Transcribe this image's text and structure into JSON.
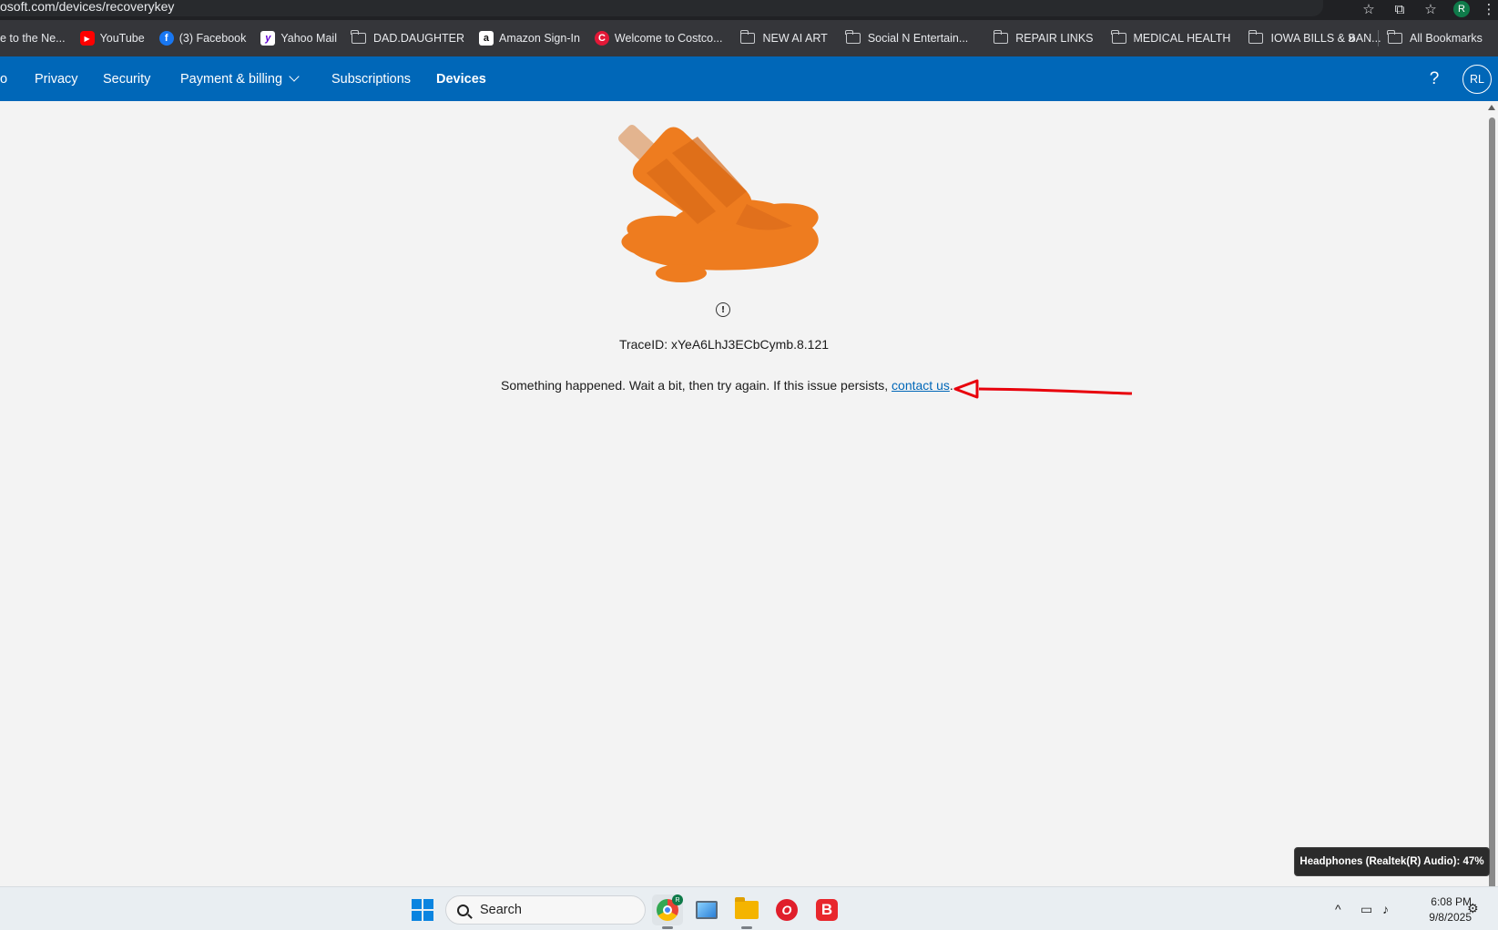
{
  "browser": {
    "url": "osoft.com/devices/recoverykey",
    "profile_initial": "R",
    "icons": [
      "star-icon",
      "extensions-icon",
      "bookmarks-icon",
      "profile-avatar",
      "menu-icon"
    ]
  },
  "bookmarks": {
    "items": [
      {
        "label": "e to the Ne...",
        "icon": "none"
      },
      {
        "label": "YouTube",
        "icon": "youtube-icon"
      },
      {
        "label": "(3) Facebook",
        "icon": "facebook-icon"
      },
      {
        "label": "Yahoo Mail",
        "icon": "yahoo-icon"
      },
      {
        "label": "DAD.DAUGHTER",
        "icon": "folder-icon"
      },
      {
        "label": "Amazon Sign-In",
        "icon": "amazon-icon"
      },
      {
        "label": "Welcome to Costco...",
        "icon": "costco-icon"
      },
      {
        "label": "NEW AI ART",
        "icon": "folder-icon"
      },
      {
        "label": "Social N Entertain...",
        "icon": "folder-icon"
      },
      {
        "label": "REPAIR LINKS",
        "icon": "folder-icon"
      },
      {
        "label": "MEDICAL HEALTH",
        "icon": "folder-icon"
      },
      {
        "label": "IOWA BILLS & BAN...",
        "icon": "folder-icon"
      }
    ],
    "more_label": "»",
    "all_bookmarks": "All Bookmarks"
  },
  "nav": {
    "partial_item": "o",
    "items": [
      "Privacy",
      "Security",
      "Payment & billing",
      "Subscriptions",
      "Devices"
    ],
    "active": "Devices",
    "help": "?",
    "account_initials": "RL"
  },
  "error": {
    "info_glyph": "!",
    "trace": "TraceID: xYeA6LhJ3ECbCymb.8.121",
    "message": "Something happened. Wait a bit, then try again. If this issue persists, ",
    "link": "contact us",
    "trailing": "."
  },
  "toast": {
    "text": "Headphones (Realtek(R) Audio): 47%"
  },
  "taskbar": {
    "search_label": "Search",
    "time": "6:08 PM",
    "date": "9/8/2025",
    "chrome_badge": "R",
    "opera_letter": "O",
    "brave_letter": "B"
  },
  "colors": {
    "nav_blue": "#0067b8",
    "popsicle_orange": "#e87722",
    "annotation_red": "#e8000b"
  }
}
